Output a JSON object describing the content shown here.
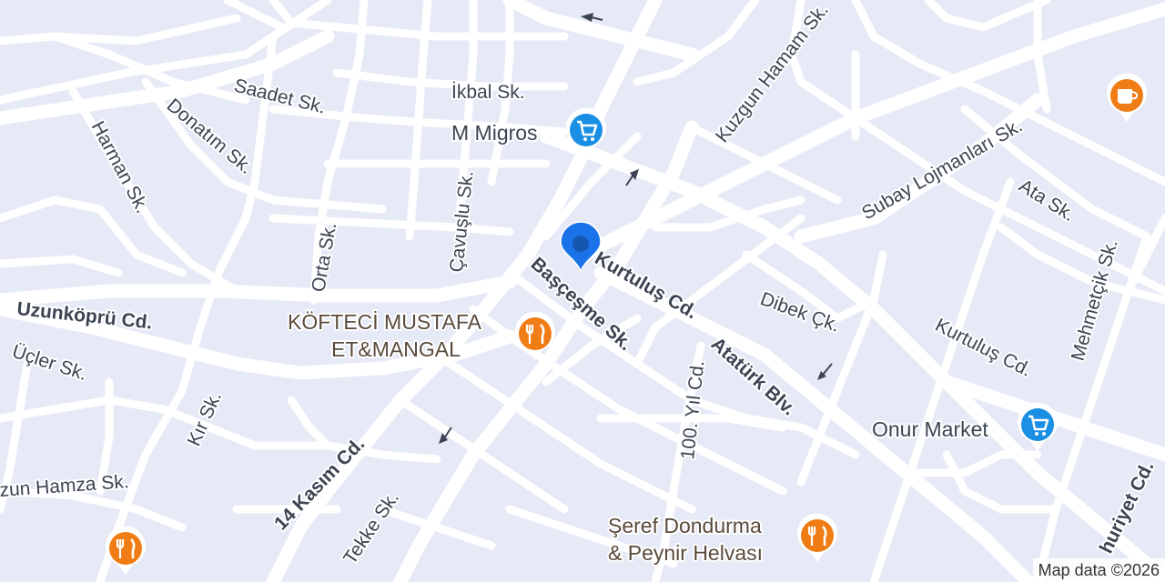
{
  "map": {
    "streets": [
      {
        "id": "saadet",
        "name": "Saadet Sk."
      },
      {
        "id": "ikbal",
        "name": "İkbal Sk."
      },
      {
        "id": "kuzgun-hamam",
        "name": "Kuzgun Hamam Sk."
      },
      {
        "id": "harman",
        "name": "Harman Sk."
      },
      {
        "id": "donatim",
        "name": "Donatım Sk."
      },
      {
        "id": "cavuslu",
        "name": "Çavuşlu Sk."
      },
      {
        "id": "orta",
        "name": "Orta Sk."
      },
      {
        "id": "subay-lojmanlari",
        "name": "Subay Lojmanları Sk."
      },
      {
        "id": "ata",
        "name": "Ata Sk."
      },
      {
        "id": "mehmetcik",
        "name": "Mehmetçik Sk."
      },
      {
        "id": "kurtulus-cd",
        "name": "Kurtuluş Cd."
      },
      {
        "id": "kurtulus-cd-2",
        "name": "Kurtuluş Cd."
      },
      {
        "id": "bascesme",
        "name": "Başçeşme Sk."
      },
      {
        "id": "uzunkopru",
        "name": "Uzunköprü Cd."
      },
      {
        "id": "dibek",
        "name": "Dibek Çk."
      },
      {
        "id": "ataturk",
        "name": "Atatürk Blv."
      },
      {
        "id": "ucler",
        "name": "Üçler Sk."
      },
      {
        "id": "kir",
        "name": "Kır Sk."
      },
      {
        "id": "yil-100",
        "name": "100. Yıl Cd."
      },
      {
        "id": "uzun-hamza",
        "name": "zun Hamza Sk."
      },
      {
        "id": "kasim-14",
        "name": "14 Kasım Cd."
      },
      {
        "id": "tekke",
        "name": "Tekke Sk."
      },
      {
        "id": "cumhuriyet",
        "name": "huriyet Cd."
      }
    ],
    "pois": [
      {
        "id": "m-migros",
        "name": "M Migros",
        "type": "shopping",
        "icon": "shopping-cart-icon",
        "color": "#1a8fe3"
      },
      {
        "id": "kofteci",
        "name_line1": "KÖFTECİ MUSTAFA",
        "name_line2": "ET&MANGAL",
        "type": "restaurant",
        "icon": "fork-knife-icon",
        "color": "#f07c16"
      },
      {
        "id": "onur-market",
        "name": "Onur Market",
        "type": "shopping",
        "icon": "shopping-cart-icon",
        "color": "#1a8fe3"
      },
      {
        "id": "seref",
        "name_line1": "Şeref Dondurma",
        "name_line2": "& Peynir Helvası",
        "type": "restaurant",
        "icon": "fork-knife-icon",
        "color": "#f07c16"
      },
      {
        "id": "cafe",
        "type": "cafe",
        "icon": "coffee-cup-icon",
        "color": "#f07c16"
      },
      {
        "id": "restaurant-sw",
        "type": "restaurant",
        "icon": "fork-knife-icon",
        "color": "#f07c16"
      }
    ],
    "location_pin": {
      "icon": "location-pin-icon",
      "color": "#1a73e8"
    },
    "attribution": "Map data ©2026",
    "colors": {
      "background": "#e6e9f6",
      "road": "#ffffff",
      "label": "#3c4452"
    }
  }
}
